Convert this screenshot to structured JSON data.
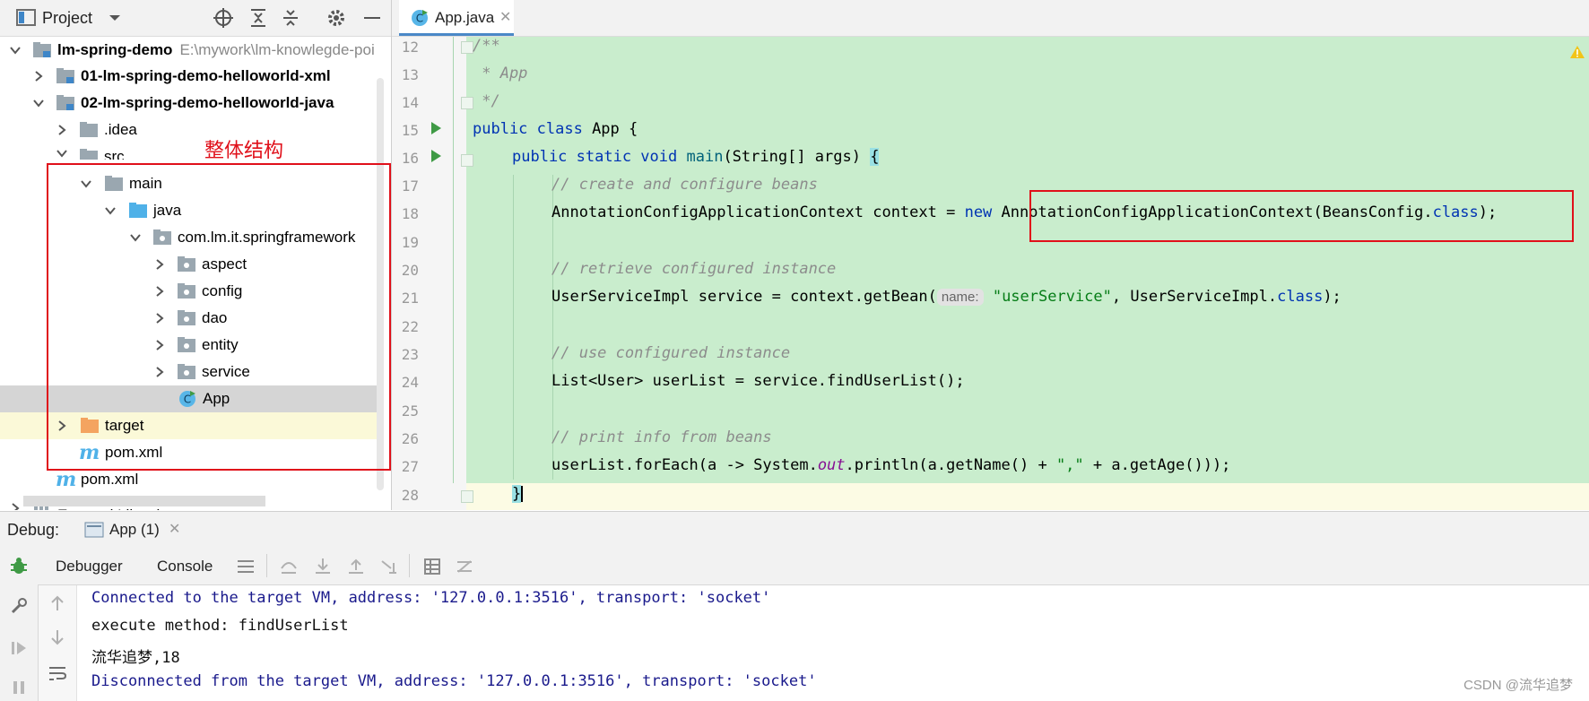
{
  "project": {
    "title": "Project",
    "tree": [
      {
        "label": "lm-spring-demo",
        "hint": "E:\\mywork\\lm-knowlegde-poi",
        "bold": true,
        "icon": "module-folder-icon",
        "expanded": true
      },
      {
        "label": "01-lm-spring-demo-helloworld-xml",
        "bold": true,
        "icon": "module-folder-icon",
        "expanded": false
      },
      {
        "label": "02-lm-spring-demo-helloworld-java",
        "bold": true,
        "icon": "module-folder-icon",
        "expanded": true
      },
      {
        "label": ".idea",
        "icon": "folder-icon",
        "expanded": false
      },
      {
        "label": "src",
        "icon": "folder-icon",
        "expanded": true
      },
      {
        "label": "main",
        "icon": "folder-icon",
        "expanded": true
      },
      {
        "label": "java",
        "icon": "source-folder-icon",
        "expanded": true
      },
      {
        "label": "com.lm.it.springframework",
        "icon": "package-icon",
        "expanded": true
      },
      {
        "label": "aspect",
        "icon": "package-icon",
        "expanded": false
      },
      {
        "label": "config",
        "icon": "package-icon",
        "expanded": false
      },
      {
        "label": "dao",
        "icon": "package-icon",
        "expanded": false
      },
      {
        "label": "entity",
        "icon": "package-icon",
        "expanded": false
      },
      {
        "label": "service",
        "icon": "package-icon",
        "expanded": false
      },
      {
        "label": "App",
        "icon": "java-class-icon",
        "selected": true
      },
      {
        "label": "target",
        "icon": "excluded-folder-icon",
        "expanded": false
      },
      {
        "label": "pom.xml",
        "icon": "maven-icon"
      },
      {
        "label": "pom.xml",
        "icon": "maven-icon"
      },
      {
        "label": "External Libraries",
        "icon": "library-icon",
        "expanded": false
      }
    ]
  },
  "annotations": {
    "tree_box_label": "整体结构"
  },
  "editor": {
    "tab_label": "App.java",
    "line_numbers": [
      "12",
      "13",
      "14",
      "15",
      "16",
      "17",
      "18",
      "19",
      "20",
      "21",
      "22",
      "23",
      "24",
      "25",
      "26",
      "27",
      "28"
    ],
    "code": {
      "l12": "/**",
      "l13": " * App",
      "l14": " */",
      "l15_kw": "public class",
      "l15_rest": " App {",
      "l16_kw1": "public static void",
      "l16_fn": "main",
      "l16_rest": "(String[] args) ",
      "l16_brace": "{",
      "l17": "// create and configure beans",
      "l18_a": "AnnotationConfigApplicationContext context = ",
      "l18_new": "new",
      "l18_b": " AnnotationConfigApplicationContext(BeansConfig.",
      "l18_class": "class",
      "l18_c": ");",
      "l20": "// retrieve configured instance",
      "l21_a": "UserServiceImpl service = context.getBean(",
      "l21_hint": "name:",
      "l21_str": "\"userService\"",
      "l21_b": ", UserServiceImpl.",
      "l21_class": "class",
      "l21_c": ");",
      "l23": "// use configured instance",
      "l24": "List<User> userList = service.findUserList();",
      "l26": "// print info from beans",
      "l27_a": "userList.forEach(a -> System.",
      "l27_out": "out",
      "l27_b": ".println(a.getName() + ",
      "l27_str": "\",\"",
      "l27_c": " + a.getAge()));",
      "l28": "}"
    }
  },
  "debug": {
    "title": "Debug:",
    "tab_label": "App (1)",
    "tabs": {
      "debugger": "Debugger",
      "console": "Console"
    },
    "console_lines": [
      {
        "text": "Connected to the target VM, address: '127.0.0.1:3516', transport: 'socket'",
        "kind": "sys"
      },
      {
        "text": "execute method: findUserList",
        "kind": "out"
      },
      {
        "text": "流华追梦,18",
        "kind": "out"
      },
      {
        "text": "Disconnected from the target VM, address: '127.0.0.1:3516', transport: 'socket'",
        "kind": "sys"
      }
    ]
  },
  "watermark": "CSDN @流华追梦",
  "colors": {
    "annotation_red": "#e0101a",
    "code_bg": "#c9edcd",
    "keyword": "#0033b3"
  }
}
